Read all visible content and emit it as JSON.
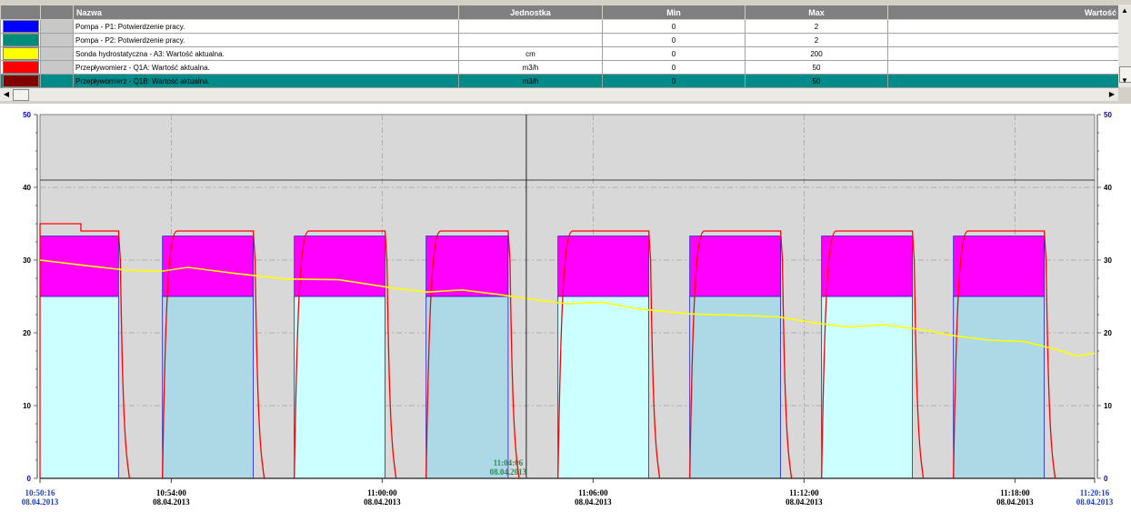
{
  "legend": {
    "columns": [
      "",
      "",
      "Nazwa",
      "Jednostka",
      "Min",
      "Max",
      "Wartość"
    ],
    "rows": [
      {
        "color": "#0000ff",
        "name": "Pompa - P1: Potwierdzenie pracy.",
        "unit": "",
        "min": "0",
        "max": "2",
        "selected": false
      },
      {
        "color": "#008b7b",
        "name": "Pompa - P2: Potwierdzenie pracy.",
        "unit": "",
        "min": "0",
        "max": "2",
        "selected": false
      },
      {
        "color": "#ffff00",
        "name": "Sonda hydrostatyczna - A3: Wartość aktualna.",
        "unit": "cm",
        "min": "0",
        "max": "200",
        "selected": false
      },
      {
        "color": "#ff0000",
        "name": "Przepływomierz - Q1A: Wartość aktualna.",
        "unit": "m3/h",
        "min": "0",
        "max": "50",
        "selected": false
      },
      {
        "color": "#800000",
        "name": "Przepływomierz - Q1B: Wartość aktualna.",
        "unit": "m3/h",
        "min": "0",
        "max": "50",
        "selected": true
      }
    ]
  },
  "scroll": {
    "up_arrow": "▲",
    "down_arrow": "▼",
    "left_arrow": "◀",
    "right_arrow": "▶"
  },
  "chart_data": {
    "type": "area",
    "xlabel": "",
    "ylabel": "",
    "ylim": [
      0,
      50
    ],
    "y_ticks": [
      "0",
      "10",
      "20",
      "30",
      "40",
      "50"
    ],
    "time_ticks": [
      {
        "time": "10:50:16",
        "date": "08.04.2013",
        "edge": true
      },
      {
        "time": "10:54:00",
        "date": "08.04.2013",
        "edge": false
      },
      {
        "time": "11:00:00",
        "date": "08.04.2013",
        "edge": false
      },
      {
        "time": "11:06:00",
        "date": "08.04.2013",
        "edge": false
      },
      {
        "time": "11:12:00",
        "date": "08.04.2013",
        "edge": false
      },
      {
        "time": "11:18:00",
        "date": "08.04.2013",
        "edge": false
      },
      {
        "time": "11:20:16",
        "date": "08.04.2013",
        "edge": true
      }
    ],
    "x_range_minutes": [
      0,
      30
    ],
    "cursor": {
      "time": "11:04:06",
      "date": "08.04.2013"
    },
    "threshold_line": 41,
    "pump_cycles": [
      {
        "pump": "P2",
        "start": "10:50:16",
        "end": "10:52:30"
      },
      {
        "pump": "P1",
        "start": "10:53:45",
        "end": "10:56:20"
      },
      {
        "pump": "P2",
        "start": "10:57:30",
        "end": "11:00:05"
      },
      {
        "pump": "P1",
        "start": "11:01:15",
        "end": "11:03:35"
      },
      {
        "pump": "P2",
        "start": "11:05:00",
        "end": "11:07:35"
      },
      {
        "pump": "P1",
        "start": "11:08:45",
        "end": "11:11:20"
      },
      {
        "pump": "P2",
        "start": "11:12:30",
        "end": "11:15:05"
      },
      {
        "pump": "P1",
        "start": "11:16:15",
        "end": "11:18:50"
      }
    ],
    "pump_fill_level": 25,
    "flow_band_top": 33.3,
    "series": [
      {
        "name": "Sonda hydrostatyczna - A3: Wartość aktualna.",
        "color": "#ffff00",
        "points": [
          [
            0,
            30
          ],
          [
            1.2,
            29.3
          ],
          [
            2.5,
            28.6
          ],
          [
            3.5,
            28.5
          ],
          [
            4.2,
            29
          ],
          [
            5.5,
            28.2
          ],
          [
            7,
            27.4
          ],
          [
            8.5,
            27.3
          ],
          [
            10,
            26.2
          ],
          [
            11,
            25.6
          ],
          [
            12,
            25.9
          ],
          [
            13,
            25.3
          ],
          [
            14,
            24.6
          ],
          [
            15,
            24
          ],
          [
            16,
            24.2
          ],
          [
            17,
            23.3
          ],
          [
            18.5,
            22.6
          ],
          [
            20,
            22.4
          ],
          [
            21,
            22.2
          ],
          [
            22,
            21.4
          ],
          [
            23,
            20.8
          ],
          [
            24,
            21.1
          ],
          [
            25,
            20.5
          ],
          [
            26,
            19.6
          ],
          [
            27,
            19
          ],
          [
            28,
            18.8
          ],
          [
            29,
            17.6
          ],
          [
            29.5,
            16.8
          ],
          [
            30,
            17.2
          ]
        ]
      },
      {
        "name": "Przepływomierz - Q1A: Wartość aktualna.",
        "color": "#ff0000",
        "plateau": 34,
        "start_peak": 35
      },
      {
        "name": "Przepływomierz - Q1B: Wartość aktualna.",
        "color": "#800000"
      }
    ],
    "colors": {
      "plot_bg": "#d8d8d8",
      "p1_fill": "#add8e6",
      "p2_fill": "#ccffff",
      "band_fill": "#ff00ff",
      "pump_outline": "#2020c0",
      "flow_line": "#ff0000",
      "level_line": "#ffff00",
      "grid": "#a0a0a0"
    }
  }
}
